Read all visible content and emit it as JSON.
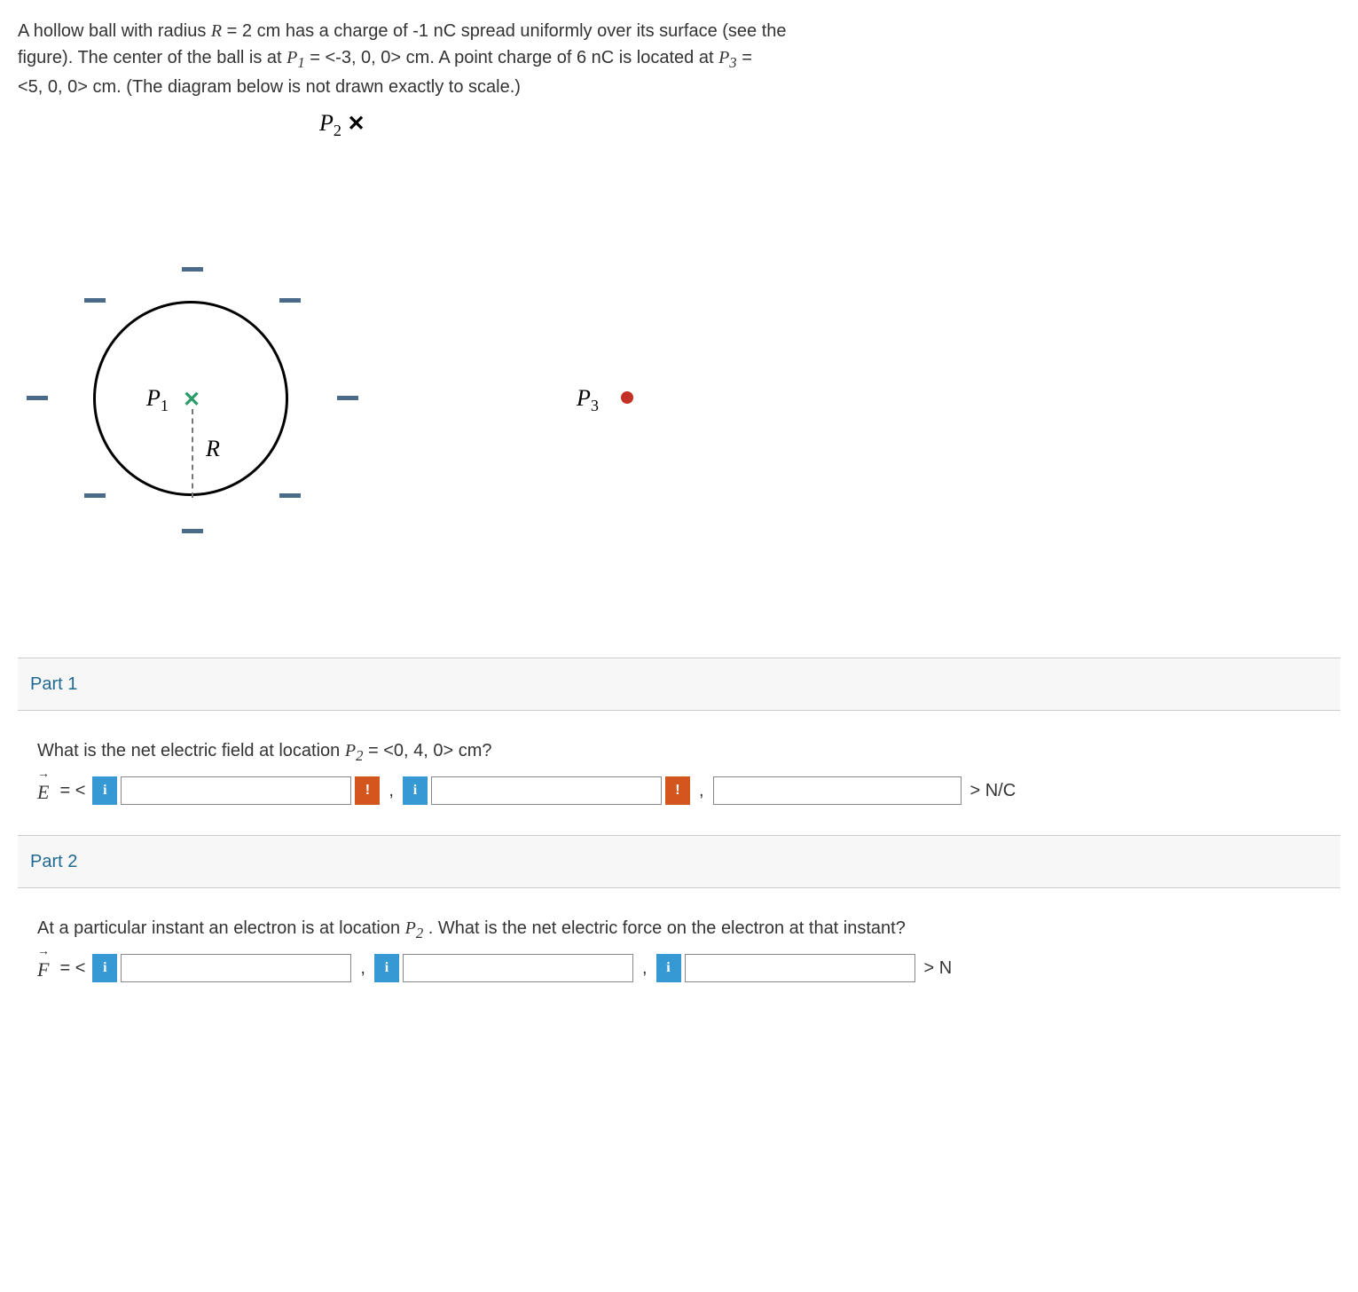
{
  "problem": {
    "line1_a": "A hollow ball with radius ",
    "R": "R",
    "eq": " = ",
    "rval": " 2 cm has a charge of -1 nC spread uniformly over its surface (see the",
    "line2_a": "figure). The center of the ball is at ",
    "P1": "P",
    "P1sub": "1",
    "p1val": " <-3, 0, 0> cm. A point charge of 6 nC is located at ",
    "P3": "P",
    "P3sub": "3",
    "line3": "<5, 0, 0> cm. (The diagram below is not drawn exactly to scale.)"
  },
  "diagram": {
    "P1": "P",
    "P1sub": "1",
    "R": "R",
    "P2": "P",
    "P2sub": "2",
    "P3": "P",
    "P3sub": "3"
  },
  "part1": {
    "title": "Part 1",
    "question_a": "What is the net electric field at location ",
    "P2": "P",
    "P2sub": "2",
    "question_b": " = <0, 4, 0> cm?",
    "vec": "E",
    "open": " = < ",
    "close": " > N/C"
  },
  "part2": {
    "title": "Part 2",
    "question_a": "At a particular instant an electron is at location ",
    "P2": "P",
    "P2sub": "2",
    "question_b": ". What is the net electric force on the electron at that instant?",
    "vec": "F",
    "open": " = < ",
    "close": " > N"
  },
  "glyphs": {
    "info": "i",
    "warn": "!",
    "x": "✕",
    "comma": ","
  }
}
